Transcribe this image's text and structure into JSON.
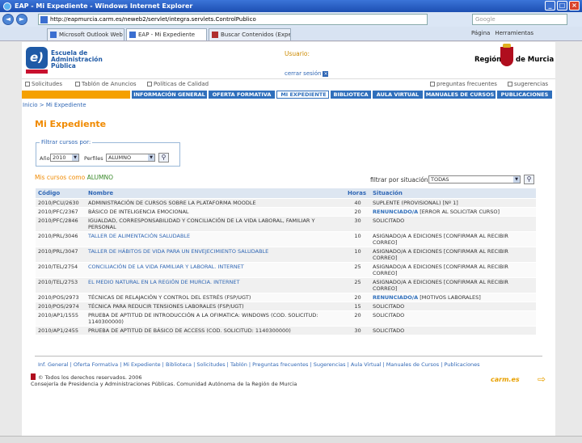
{
  "browser": {
    "window_title": "EAP - Mi Expediente - Windows Internet Explorer",
    "url": "http://eapmurcia.carm.es/neweb2/servlet/integra.servlets.ControlPublico",
    "search_placeholder": "Google",
    "tabs": [
      {
        "label": "Microsoft Outlook Web Access"
      },
      {
        "label": "EAP - Mi Expediente"
      },
      {
        "label": "Buscar Contenidos (Expedien..."
      }
    ],
    "page_menu": "Página",
    "tools_menu": "Herramientas"
  },
  "header": {
    "logo_text_1": "Escuela de",
    "logo_text_2": "Administración",
    "logo_text_3": "Pública",
    "logo_letters": "e)",
    "usuario_label": "Usuario:",
    "logout": "cerrar sesión",
    "region_1": "Región",
    "region_2": "de Murcia"
  },
  "top_links": {
    "solicitudes": "Solicitudes",
    "tablon": "Tablón de Anuncios",
    "politicas": "Políticas de Calidad",
    "faq": "preguntas frecuentes",
    "sugerencias": "sugerencias"
  },
  "menu": [
    {
      "label": "INFORMACIÓN GENERAL"
    },
    {
      "label": "OFERTA FORMATIVA"
    },
    {
      "label": "MI EXPEDIENTE"
    },
    {
      "label": "BIBLIOTECA"
    },
    {
      "label": "AULA VIRTUAL"
    },
    {
      "label": "MANUALES DE CURSOS"
    },
    {
      "label": "PUBLICACIONES"
    }
  ],
  "breadcrumb": "Inicio > Mi Expediente",
  "page_title": "Mi Expediente",
  "filter": {
    "legend": "Filtrar cursos por:",
    "year_label": "Año",
    "year_value": "2010",
    "profile_label": "Perfiles",
    "profile_value": "ALUMNO"
  },
  "courses": {
    "heading": "Mis cursos como",
    "role": "ALUMNO",
    "situation_filter_label": "filtrar por situación",
    "situation_filter_value": "TODAS",
    "columns": {
      "code": "Código",
      "name": "Nombre",
      "hours": "Horas",
      "status": "Situación"
    },
    "rows": [
      {
        "code": "2010/PCU/2630",
        "name": "ADMINISTRACIÓN DE CURSOS SOBRE LA PLATAFORMA MOODLE",
        "hours": "40",
        "status": "SUPLENTE (PROVISIONAL)  [Nº 1]",
        "status_strong": ""
      },
      {
        "code": "2010/PFC/2367",
        "name": "BÁSICO DE INTELIGENCIA EMOCIONAL",
        "hours": "20",
        "status_strong": "RENUNCIADO/A",
        "status": "[ERROR AL SOLICITAR CURSO]"
      },
      {
        "code": "2010/PFC/2846",
        "name": "IGUALDAD, CORRESPONSABILIDAD Y CONCILIACIÓN DE LA VIDA LABORAL, FAMILIAR Y PERSONAL",
        "hours": "30",
        "status": "SOLICITADO",
        "status_strong": ""
      },
      {
        "code": "2010/PRL/3046",
        "name": "TALLER DE ALIMENTACIÓN SALUDABLE",
        "hours": "10",
        "status": "ASIGNADO/A A EDICIONES  [CONFIRMAR AL RECIBIR CORREO]",
        "status_strong": "",
        "link": true
      },
      {
        "code": "2010/PRL/3047",
        "name": "TALLER DE HÁBITOS DE VIDA PARA UN ENVEJECIMIENTO SALUDABLE",
        "hours": "10",
        "status": "ASIGNADO/A A EDICIONES  [CONFIRMAR AL RECIBIR CORREO]",
        "status_strong": "",
        "link": true
      },
      {
        "code": "2010/TEL/2754",
        "name": "CONCILIACIÓN DE LA VIDA FAMILIAR Y LABORAL. INTERNET",
        "hours": "25",
        "status": "ASIGNADO/A A EDICIONES  [CONFIRMAR AL RECIBIR CORREO]",
        "status_strong": "",
        "link": true
      },
      {
        "code": "2010/TEL/2753",
        "name": "EL MEDIO NATURAL EN LA REGIÓN DE MURCIA. INTERNET",
        "hours": "25",
        "status": "ASIGNADO/A A EDICIONES  [CONFIRMAR AL RECIBIR CORREO]",
        "status_strong": "",
        "link": true
      },
      {
        "code": "2010/POS/2973",
        "name": "TÉCNICAS DE RELAJACIÓN Y CONTROL DEL ESTRÉS (FSP/UGT)",
        "hours": "20",
        "status_strong": "RENUNCIADO/A",
        "status": "[MOTIVOS LABORALES]"
      },
      {
        "code": "2010/POS/2974",
        "name": "TÉCNICA PARA REDUCIR TENSIONES LABORALES (FSP/UGT)",
        "hours": "15",
        "status": "SOLICITADO",
        "status_strong": ""
      },
      {
        "code": "2010/AP1/1555",
        "name": "PRUEBA DE APTITUD DE INTRODUCCIÓN A LA OFIMATICA: WINDOWS (COD. SOLICITUD: 1140300000)",
        "hours": "20",
        "status": "SOLICITADO",
        "status_strong": ""
      },
      {
        "code": "2010/AP1/2455",
        "name": "PRUEBA DE APTITUD DE BÁSICO DE ACCESS (COD. SOLICITUD: 1140300000)",
        "hours": "30",
        "status": "SOLICITADO",
        "status_strong": ""
      }
    ]
  },
  "footer": {
    "links": "Inf. General | Oferta Formativa | Mi Expediente | Biblioteca | Solicitudes | Tablón | Preguntas frecuentes | Sugerencias | Aula Virtual | Manuales de Cursos | Publicaciones",
    "copyright": "© Todos los derechos reservados. 2006",
    "org": "Consejería de Presidencia y Administraciones Públicas. Comunidad Autónoma de la Región de Murcia",
    "carm": "carm.es"
  }
}
